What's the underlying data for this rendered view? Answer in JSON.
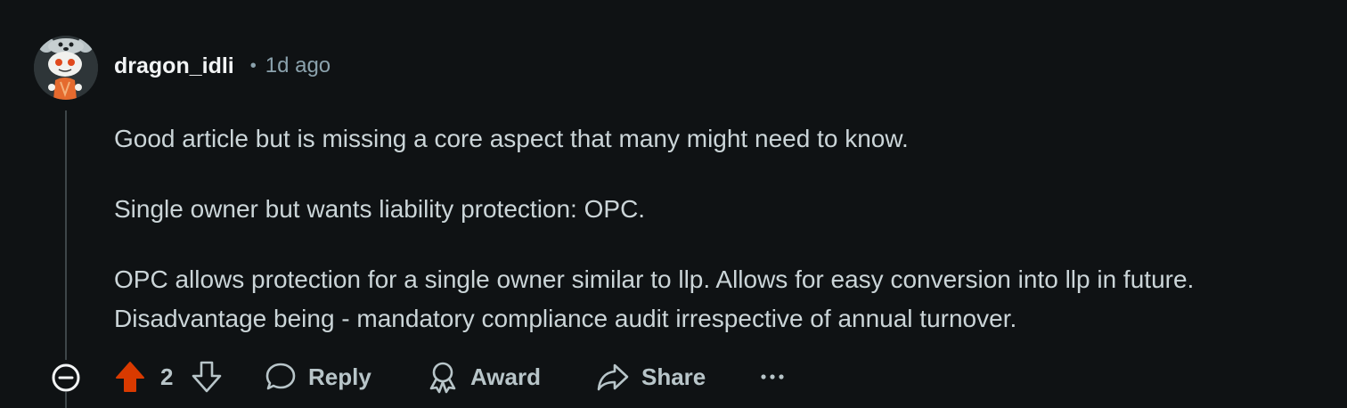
{
  "comment": {
    "username": "dragon_idli",
    "separator": "•",
    "timestamp": "1d ago",
    "paragraphs": [
      "Good article but is missing a core aspect that many might need to know.",
      "Single owner but wants liability protection: OPC.",
      "OPC allows protection for a single owner similar to llp. Allows for easy conversion into llp in future. Disadvantage being - mandatory compliance audit irrespective of annual turnover."
    ],
    "avatar_icon": "snoo-avatar"
  },
  "actions": {
    "upvote_icon": "upvote-arrow-icon",
    "vote_count": "2",
    "downvote_icon": "downvote-arrow-icon",
    "reply_label": "Reply",
    "award_label": "Award",
    "share_label": "Share",
    "more_label": "···",
    "upvote_active": true
  },
  "colors": {
    "background": "#0f1214",
    "upvote": "#d93a00",
    "text": "#cbd5d8",
    "muted": "#8ba2ad"
  }
}
